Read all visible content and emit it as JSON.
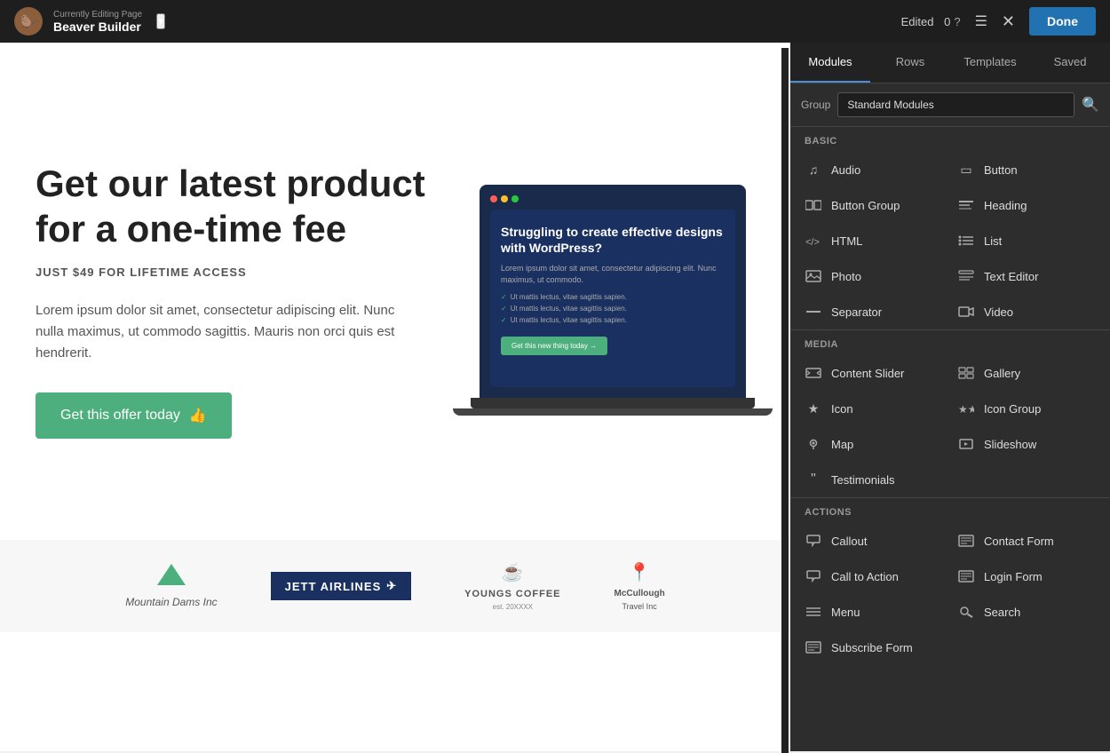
{
  "topbar": {
    "editing_label": "Currently Editing Page",
    "app_name": "Beaver Builder",
    "edited_text": "Edited",
    "edited_count": "0",
    "done_label": "Done"
  },
  "hero": {
    "title": "Get our latest product for a one-time fee",
    "subtitle": "JUST $49 FOR LIFETIME ACCESS",
    "body": "Lorem ipsum dolor sit amet, consectetur adipiscing elit. Nunc nulla maximus, ut commodo sagittis. Mauris non orci quis est hendrerit.",
    "cta_label": "Get this offer today"
  },
  "laptop": {
    "title": "Struggling to create effective designs with WordPress?",
    "body_text": "Lorem ipsum dolor sit amet, consectetur adipiscing elit. Nunc maximus, ut commodo.",
    "items": [
      "Ut mattis lectus, vitae sagittis sapien.",
      "Ut mattis lectus, vitae sagittis sapien.",
      "Ut mattis lectus, vitae sagittis sapien."
    ],
    "cta": "Get this new thing today →"
  },
  "logos": [
    {
      "type": "mountain",
      "name": "Mountain Dams Inc"
    },
    {
      "type": "airline",
      "name": "JETT AIRLINES",
      "tagline": "✈"
    },
    {
      "type": "coffee",
      "name": "YOUNGS COFFEE"
    },
    {
      "type": "travel",
      "name": "McCullough Travel Inc"
    }
  ],
  "panel": {
    "tabs": [
      "Modules",
      "Rows",
      "Templates",
      "Saved"
    ],
    "active_tab": 0,
    "group_label": "Group",
    "group_value": "Standard Modules",
    "sections": {
      "basic": {
        "header": "Basic",
        "modules": [
          {
            "icon": "♫",
            "label": "Audio"
          },
          {
            "icon": "▭",
            "label": "Button"
          },
          {
            "icon": "▭▭",
            "label": "Button Group"
          },
          {
            "icon": "☰",
            "label": "Heading"
          },
          {
            "icon": "</>",
            "label": "HTML"
          },
          {
            "icon": "≡",
            "label": "List"
          },
          {
            "icon": "▨",
            "label": "Photo"
          },
          {
            "icon": "≣",
            "label": "Text Editor"
          },
          {
            "icon": "—",
            "label": "Separator"
          },
          {
            "icon": "▶",
            "label": "Video"
          }
        ]
      },
      "media": {
        "header": "Media",
        "modules": [
          {
            "icon": "▶▶",
            "label": "Content Slider"
          },
          {
            "icon": "▦",
            "label": "Gallery"
          },
          {
            "icon": "★",
            "label": "Icon"
          },
          {
            "icon": "★★",
            "label": "Icon Group"
          },
          {
            "icon": "◎",
            "label": "Map"
          },
          {
            "icon": "▶▶",
            "label": "Slideshow"
          },
          {
            "icon": "❝❝",
            "label": "Testimonials"
          }
        ]
      },
      "actions": {
        "header": "Actions",
        "modules": [
          {
            "icon": "📣",
            "label": "Callout"
          },
          {
            "icon": "▦",
            "label": "Contact Form"
          },
          {
            "icon": "📣",
            "label": "Call to Action"
          },
          {
            "icon": "▦",
            "label": "Login Form"
          },
          {
            "icon": "≡",
            "label": "Menu"
          },
          {
            "icon": "🔍",
            "label": "Search"
          },
          {
            "icon": "▦",
            "label": "Subscribe Form"
          }
        ]
      }
    }
  }
}
